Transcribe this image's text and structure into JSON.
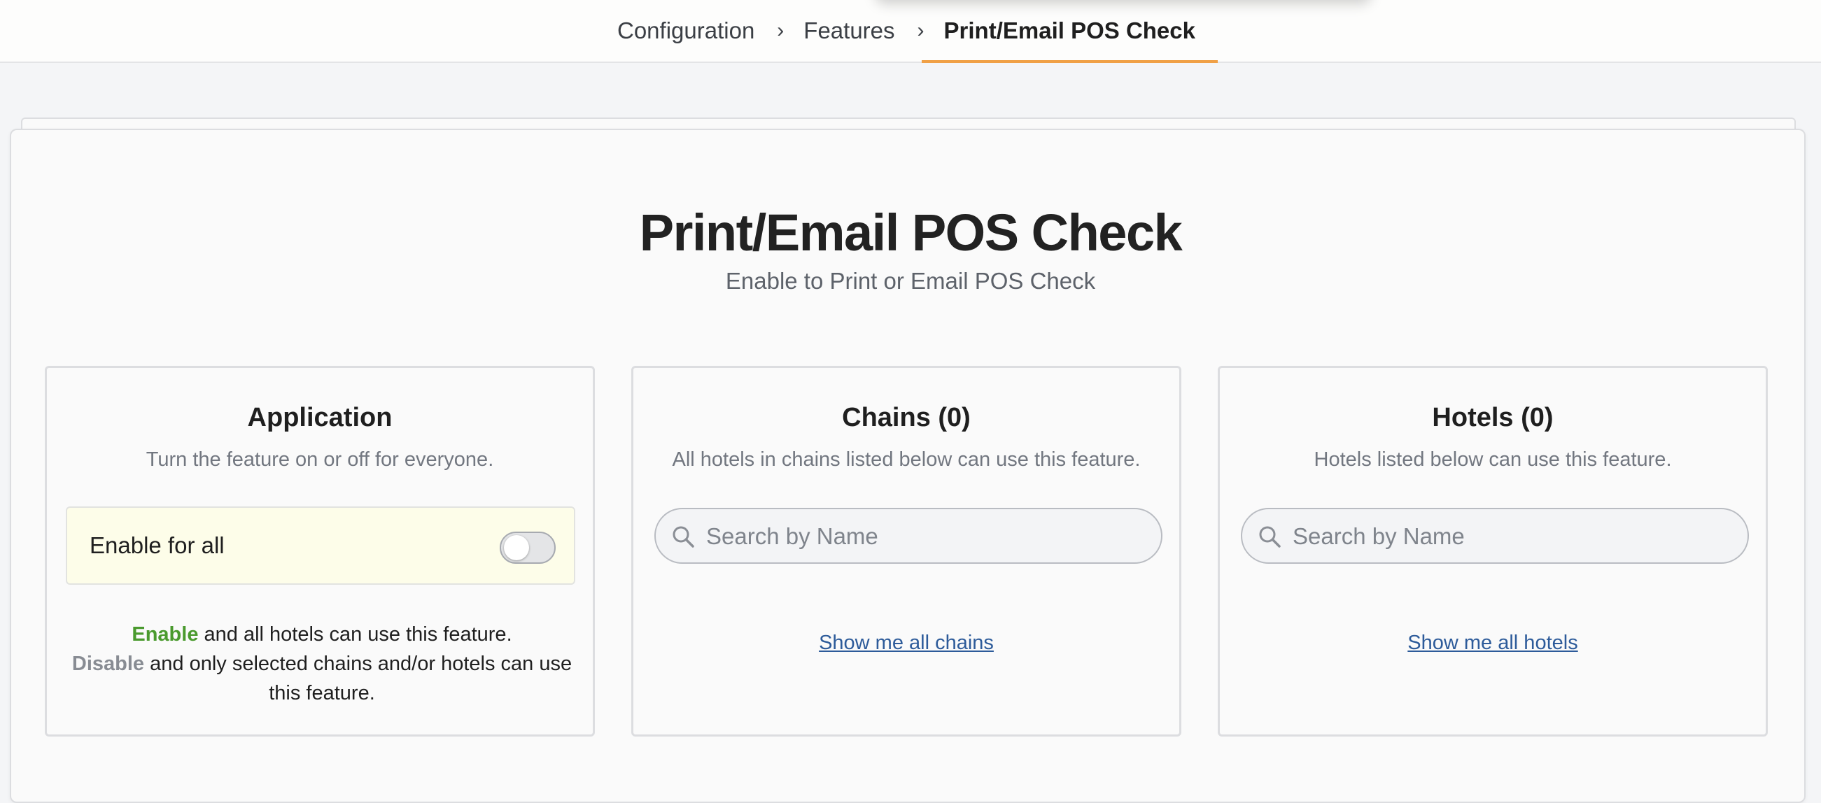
{
  "breadcrumb": {
    "items": [
      "Configuration",
      "Features"
    ],
    "separator": "›",
    "current": "Print/Email POS Check"
  },
  "page": {
    "title": "Print/Email POS Check",
    "subtitle": "Enable to Print or Email POS Check"
  },
  "application": {
    "title": "Application",
    "description": "Turn the feature on or off for everyone.",
    "toggle_label": "Enable for all",
    "toggle_on": false,
    "enable_word": "Enable",
    "enable_text": " and all hotels can use this feature.",
    "disable_word": "Disable",
    "disable_text": " and only selected chains and/or hotels can use this feature."
  },
  "chains": {
    "title": "Chains (0)",
    "description": "All hotels in chains listed below can use this feature.",
    "search_placeholder": "Search by Name",
    "search_value": "",
    "show_all_link": "Show me all chains"
  },
  "hotels": {
    "title": "Hotels (0)",
    "description": "Hotels listed below can use this feature.",
    "search_placeholder": "Search by Name",
    "search_value": "",
    "show_all_link": "Show me all hotels"
  },
  "colors": {
    "accent": "#f0a046",
    "enable": "#4a9a2e",
    "link": "#2d5b9a"
  }
}
